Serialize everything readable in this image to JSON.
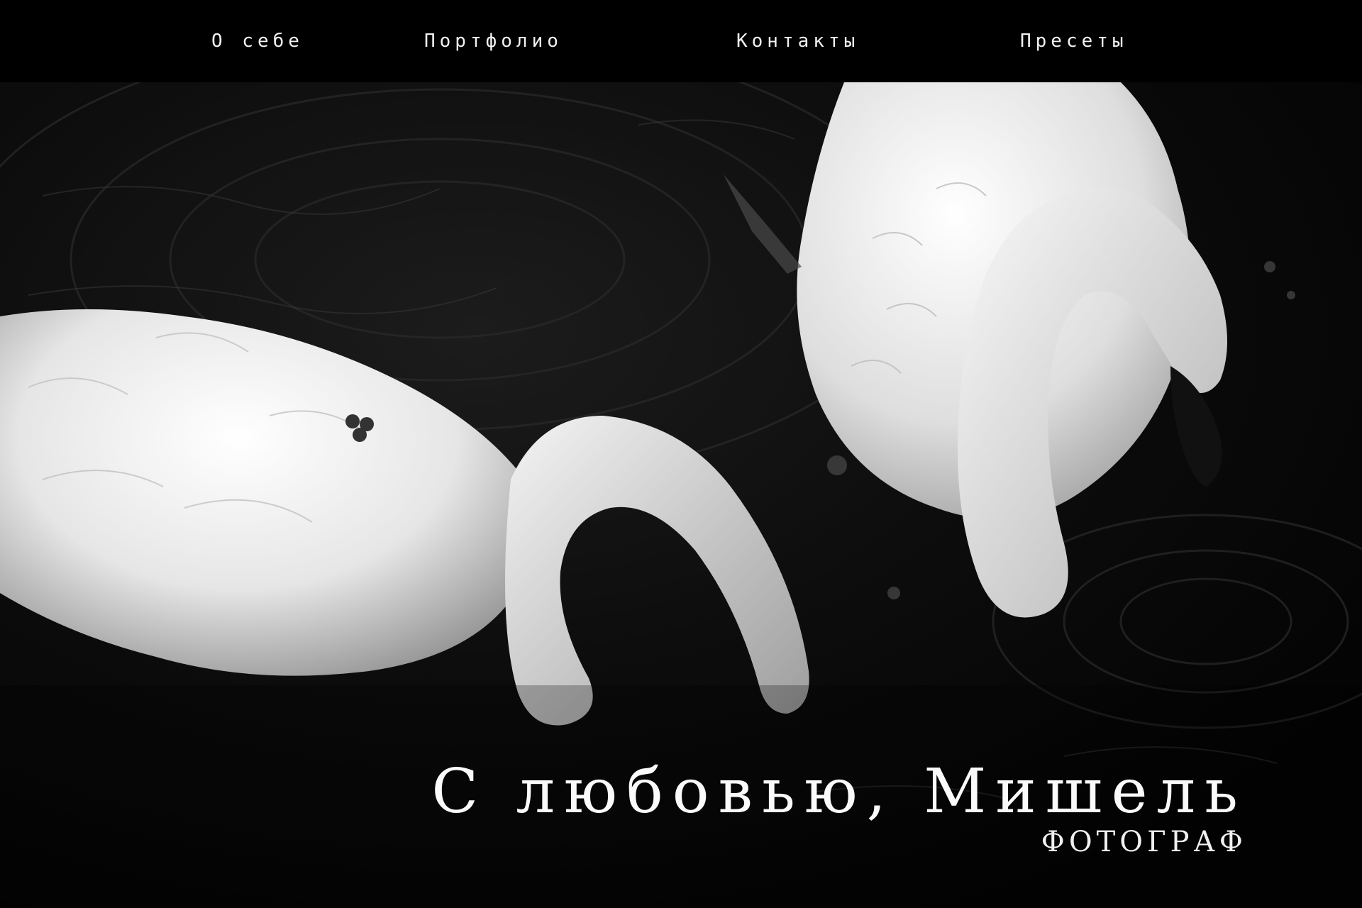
{
  "nav": {
    "items": [
      {
        "label": "О себе"
      },
      {
        "label": "Портфолио"
      },
      {
        "label": "Контакты"
      },
      {
        "label": "Пресеты"
      }
    ]
  },
  "hero": {
    "image": "black-and-white-photo-two-swans-on-dark-water",
    "title": "С любовью, Мишель",
    "subtitle": "ФОТОГРАФ"
  },
  "colors": {
    "nav_background": "#000000",
    "text": "#ffffff",
    "water": "#0a0a0a"
  }
}
